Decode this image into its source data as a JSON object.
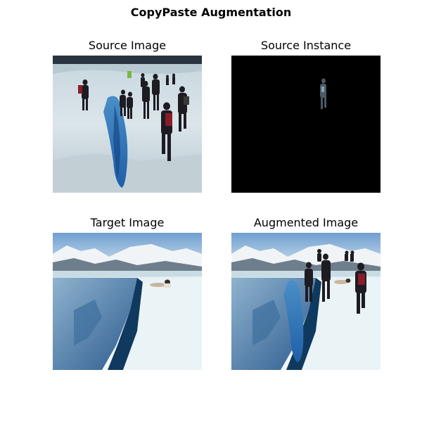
{
  "figure": {
    "title": "CopyPaste Augmentation",
    "panels": [
      {
        "title": "Source Image",
        "icon": "photo-hikers-on-glacier"
      },
      {
        "title": "Source Instance",
        "icon": "masked-single-hiker"
      },
      {
        "title": "Target Image",
        "icon": "photo-glacier-crevasse"
      },
      {
        "title": "Augmented Image",
        "icon": "photo-glacier-with-pasted-hikers"
      }
    ]
  }
}
